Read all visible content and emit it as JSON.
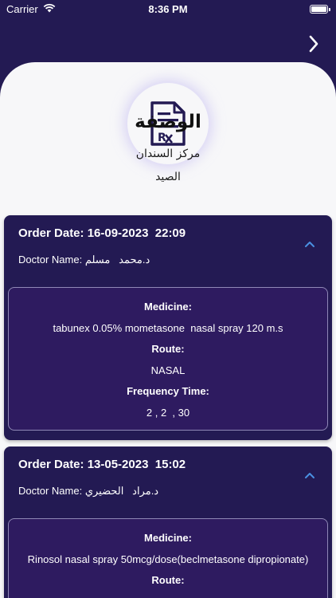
{
  "status_bar": {
    "carrier": "Carrier",
    "time": "8:36 PM"
  },
  "header": {
    "title": "الوصفة",
    "center_name": "مركز السندان",
    "pharmacy": "الصيد",
    "logo_icon": "prescription-rx-icon",
    "nav_icon": "chevron-right-icon"
  },
  "labels": {
    "medicine": "Medicine:",
    "route": "Route:",
    "frequency": "Frequency Time:"
  },
  "prescriptions": [
    {
      "order_date": "Order Date: 16-09-2023  22:09",
      "doctor": "Doctor Name: د.محمد   مسلم",
      "medicine": "tabunex 0.05% mometasone  nasal spray 120 m.s",
      "route": "NASAL",
      "frequency": "2 , 2  , 30"
    },
    {
      "order_date": "Order Date: 13-05-2023  15:02",
      "doctor": "Doctor Name: د.مراد   الحضيري",
      "medicine": "Rinosol nasal spray 50mcg/dose(beclmetasone dipropionate)"
    }
  ],
  "colors": {
    "primary": "#231a53",
    "inner_box": "#2e1b60",
    "accent": "#4a90e2",
    "background": "#f7f7f9"
  }
}
